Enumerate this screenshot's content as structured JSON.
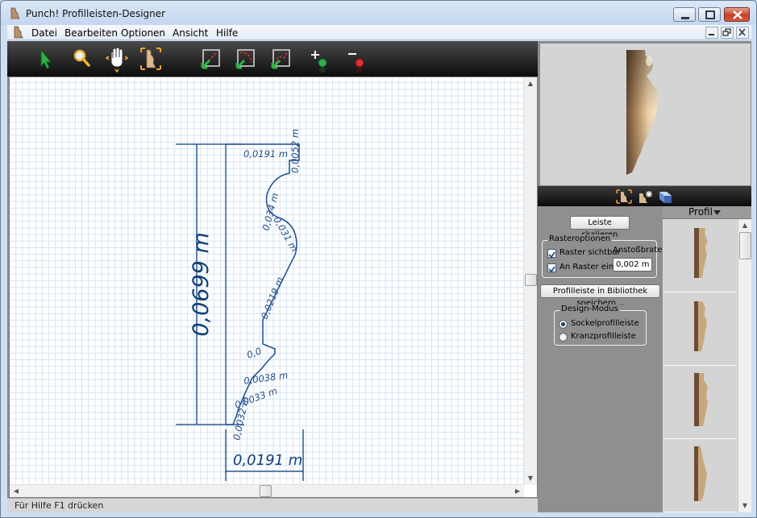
{
  "window": {
    "title": "Punch! Profilleisten-Designer",
    "icon": "molding-app-icon"
  },
  "menubar": {
    "items": [
      "Datei",
      "Bearbeiten",
      "Optionen",
      "Ansicht",
      "Hilfe"
    ]
  },
  "toolbar": {
    "tools": [
      "select-arrow-icon",
      "zoom-magnifier-icon",
      "pan-hand-icon",
      "profile-frame-icon",
      "line-tool-icon",
      "arc-tool-icon",
      "curve-tool-icon",
      "add-point-icon",
      "remove-point-icon"
    ]
  },
  "canvas": {
    "dimensions": {
      "height_total": "0,0699 m",
      "width_total": "0,0191 m"
    },
    "segment_labels": {
      "top_width": "0,0191 m",
      "top_step": "0,0052 m",
      "cove": "0,034 m",
      "ogee": "0,031 m",
      "straight": "0,0219 m",
      "lower_1": "0,0",
      "lower_2": "0,0038 m",
      "lower_3": "0,0033 m",
      "bottom": "0,0032 m"
    }
  },
  "status": {
    "text": "Für Hilfe F1 drücken"
  },
  "preview": {
    "tabs": [
      "profile-view-icon",
      "light-render-icon",
      "3d-render-icon"
    ]
  },
  "controls": {
    "scale_button": "Leiste skalieren",
    "raster_group": "Rasteroptionen",
    "raster_visible_label": "Raster sichtbar",
    "raster_visible_checked": true,
    "snap_label": "An Raster einr.",
    "snap_checked": true,
    "spacing_label": "Anstoßbrate:",
    "spacing_value": "0,002 m",
    "save_button": "Profilleiste in Bibliothek speichern...",
    "design_group": "Design-Modus",
    "modes": [
      "Sockelprofilleiste",
      "Kranzprofilleiste"
    ],
    "selected_mode": "Sockelprofilleiste"
  },
  "gallery": {
    "header": "Profil",
    "thumbnail_count": 4
  },
  "colors": {
    "dimension_line": "#0f3f78",
    "profile_line": "#1e4c8f",
    "grid": "#d4e3f3",
    "panel_gray": "#8f8f8f",
    "wood_light": "#e8c9a1",
    "wood_dark": "#7a5a3c"
  }
}
